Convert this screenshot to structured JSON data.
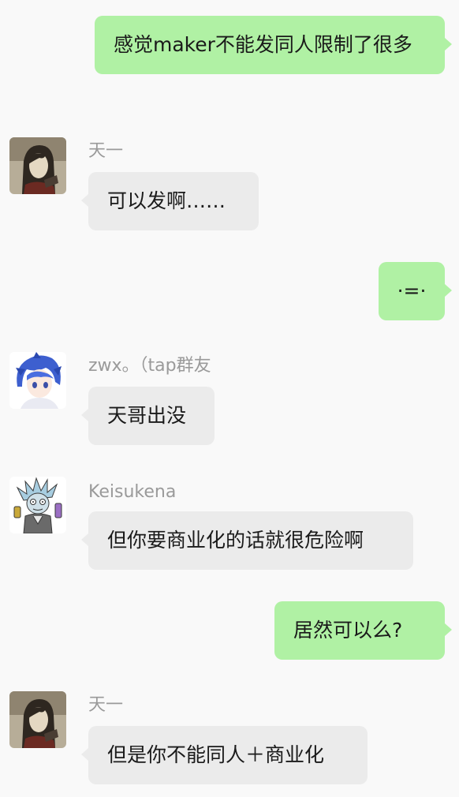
{
  "messages": [
    {
      "sender": "",
      "direction": "out",
      "text": "感觉maker不能发同人限制了很多"
    },
    {
      "sender": "天一",
      "direction": "in",
      "avatar": "portrait-avatar-long-hair",
      "text": "可以发啊……"
    },
    {
      "sender": "",
      "direction": "out",
      "text": "·=·"
    },
    {
      "sender": "zwx。（tap群友",
      "direction": "in",
      "avatar": "anime-blue-hair-avatar",
      "text": "天哥出没"
    },
    {
      "sender": "Keisukena",
      "direction": "in",
      "avatar": "cartoon-scientist-avatar",
      "text": "但你要商业化的话就很危险啊"
    },
    {
      "sender": "",
      "direction": "out",
      "text": "居然可以么?"
    },
    {
      "sender": "天一",
      "direction": "in",
      "avatar": "portrait-avatar-long-hair",
      "text": "但是你不能同人＋商业化"
    }
  ],
  "colors": {
    "background": "#f9f9f9",
    "incoming_bubble": "#ebebeb",
    "outgoing_bubble": "#b0f1a4",
    "sender_name": "#9a9a9a"
  }
}
